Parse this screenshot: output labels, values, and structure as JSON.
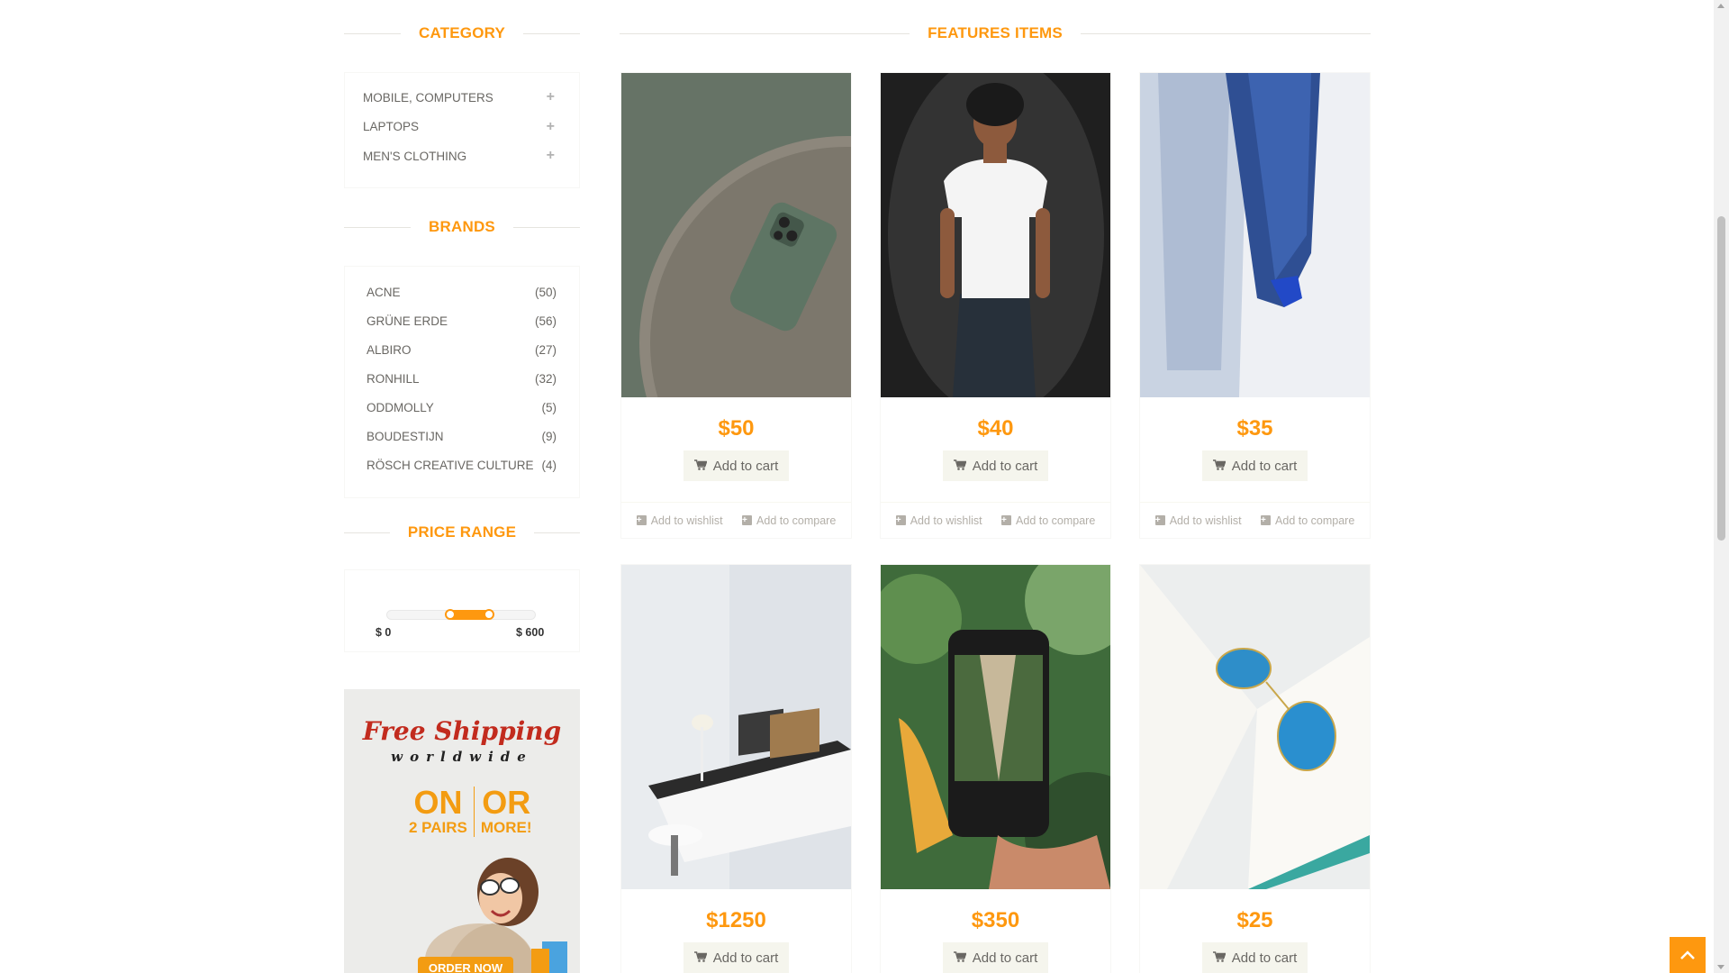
{
  "sidebar": {
    "category_title": "CATEGORY",
    "categories": [
      {
        "label": "MOBILE, COMPUTERS",
        "icon": "plus-icon"
      },
      {
        "label": "LAPTOPS",
        "icon": "plus-icon"
      },
      {
        "label": "MEN'S CLOTHING",
        "icon": "plus-icon"
      }
    ],
    "brands_title": "BRANDS",
    "brands": [
      {
        "name": "ACNE",
        "count": "(50)"
      },
      {
        "name": "GRÜNE ERDE",
        "count": "(56)"
      },
      {
        "name": "ALBIRO",
        "count": "(27)"
      },
      {
        "name": "RONHILL",
        "count": "(32)"
      },
      {
        "name": "ODDMOLLY",
        "count": "(5)"
      },
      {
        "name": "BOUDESTIJN",
        "count": "(9)"
      },
      {
        "name": "RÖSCH CREATIVE CULTURE",
        "count": "(4)"
      }
    ],
    "price_title": "PRICE RANGE",
    "price_min_label": "$ 0",
    "price_max_label": "$ 600",
    "price_selected": {
      "from_fraction": 0.42,
      "to_fraction": 0.68
    },
    "banner": {
      "title": "Free Shipping",
      "subtitle": "worldwide",
      "left_big": "ON",
      "left_small": "2 PAIRS",
      "right_big": "OR",
      "right_small": "MORE!",
      "cta": "ORDER NOW"
    }
  },
  "main": {
    "title": "FEATURES ITEMS",
    "products": [
      {
        "price": "$50",
        "image": "green-phone-on-table",
        "cart_label": "Add to cart",
        "wishlist_label": "Add to wishlist",
        "compare_label": "Add to compare"
      },
      {
        "price": "$40",
        "image": "man-in-white-tshirt",
        "cart_label": "Add to cart",
        "wishlist_label": "Add to wishlist",
        "compare_label": "Add to compare"
      },
      {
        "price": "$35",
        "image": "hanging-denim-jeans",
        "cart_label": "Add to cart",
        "wishlist_label": "Add to wishlist",
        "compare_label": "Add to compare"
      },
      {
        "price": "$1250",
        "image": "laptop-desk-setup",
        "cart_label": "Add to cart"
      },
      {
        "price": "$350",
        "image": "hand-holding-phone",
        "cart_label": "Add to cart"
      },
      {
        "price": "$25",
        "image": "sunglasses-on-book",
        "cart_label": "Add to cart"
      }
    ]
  },
  "colors": {
    "accent": "#FE980F",
    "button_bg": "#F5F5ED",
    "text": "#696763",
    "muted": "#B3AFA8"
  }
}
